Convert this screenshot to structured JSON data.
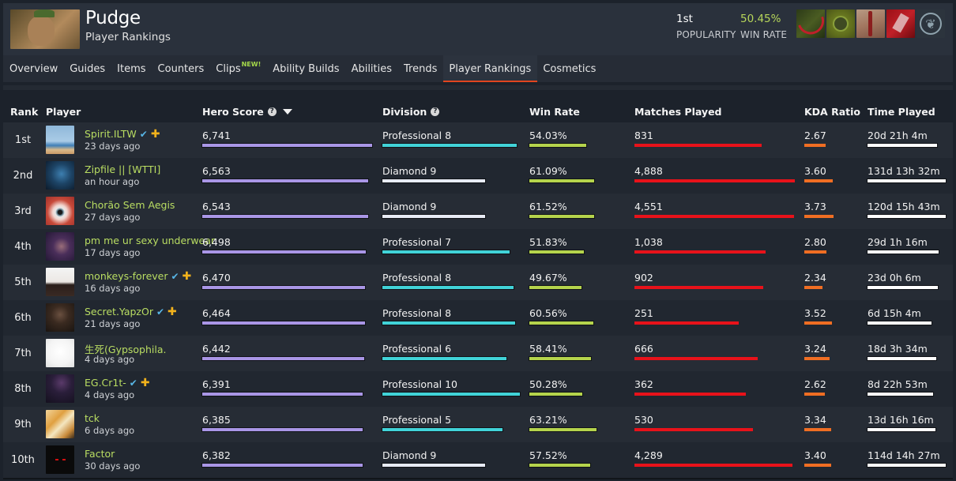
{
  "hero": {
    "name": "Pudge",
    "subtitle": "Player Rankings",
    "popularity_value": "1st",
    "popularity_label": "POPULARITY",
    "win_rate_value": "50.45%",
    "win_rate_label": "WIN RATE",
    "abilities": [
      "meat-hook-icon",
      "rot-icon",
      "flesh-heap-icon",
      "dismember-icon",
      "talent-tree-icon"
    ]
  },
  "nav": {
    "items": [
      {
        "label": "Overview"
      },
      {
        "label": "Guides"
      },
      {
        "label": "Items"
      },
      {
        "label": "Counters"
      },
      {
        "label": "Clips",
        "badge": "NEW!"
      },
      {
        "label": "Ability Builds"
      },
      {
        "label": "Abilities"
      },
      {
        "label": "Trends"
      },
      {
        "label": "Player Rankings",
        "active": true
      },
      {
        "label": "Cosmetics"
      }
    ]
  },
  "colors": {
    "hero_score_bar": "#a996e6",
    "professional_bar": "#41d3d8",
    "diamond_bar": "#e7ebf5",
    "win_rate_bar": "#b5d44c",
    "matches_bar": "#e8121a",
    "kda_bar": "#f06e23",
    "time_bar": "#ffffff",
    "accent": "#e2451f",
    "player_name": "#b9dd62"
  },
  "table": {
    "headers": {
      "rank": "Rank",
      "player": "Player",
      "hero_score": "Hero Score",
      "division": "Division",
      "win_rate": "Win Rate",
      "matches": "Matches Played",
      "kda": "KDA Ratio",
      "time": "Time Played"
    },
    "rows": [
      {
        "rank": "1st",
        "name": "Spirit.ILTW",
        "verified": true,
        "plus": true,
        "last_seen": "23 days ago",
        "hero_score": "6,741",
        "hero_score_frac": 1.0,
        "division": "Professional 8",
        "division_type": "professional",
        "division_frac": 0.977,
        "win_rate": "54.03%",
        "win_rate_frac": 0.847,
        "matches": "831",
        "matches_frac": 0.792,
        "kda": "2.67",
        "kda_frac": 0.73,
        "time": "20d 21h 4m",
        "time_frac": 0.889,
        "avatar": "fox"
      },
      {
        "rank": "2nd",
        "name": "Zipfile || [WTTI]",
        "verified": false,
        "plus": false,
        "last_seen": "an hour ago",
        "hero_score": "6,563",
        "hero_score_frac": 0.977,
        "division": "Diamond 9",
        "division_type": "diamond",
        "division_frac": 0.747,
        "win_rate": "61.09%",
        "win_rate_frac": 0.965,
        "matches": "4,888",
        "matches_frac": 1.0,
        "kda": "3.60",
        "kda_frac": 0.973,
        "time": "131d 13h 32m",
        "time_frac": 1.0,
        "avatar": "blue-face"
      },
      {
        "rank": "3rd",
        "name": "Chorão Sem Aegis",
        "verified": false,
        "plus": false,
        "last_seen": "27 days ago",
        "hero_score": "6,543",
        "hero_score_frac": 0.977,
        "division": "Diamond 9",
        "division_type": "diamond",
        "division_frac": 0.747,
        "win_rate": "61.52%",
        "win_rate_frac": 0.965,
        "matches": "4,551",
        "matches_frac": 0.995,
        "kda": "3.73",
        "kda_frac": 1.0,
        "time": "120d 15h 43m",
        "time_frac": 1.0,
        "avatar": "eye"
      },
      {
        "rank": "4th",
        "name": "pm me ur sexy underwear",
        "verified": false,
        "plus": false,
        "last_seen": "17 days ago",
        "hero_score": "6,498",
        "hero_score_frac": 0.963,
        "division": "Professional 7",
        "division_type": "professional",
        "division_frac": 0.925,
        "win_rate": "51.83%",
        "win_rate_frac": 0.812,
        "matches": "1,038",
        "matches_frac": 0.817,
        "kda": "2.80",
        "kda_frac": 0.757,
        "time": "29d 1h 16m",
        "time_frac": 0.909,
        "avatar": "purple-woman"
      },
      {
        "rank": "5th",
        "name": "monkeys-forever",
        "verified": true,
        "plus": true,
        "last_seen": "16 days ago",
        "hero_score": "6,470",
        "hero_score_frac": 0.958,
        "division": "Professional 8",
        "division_type": "professional",
        "division_frac": 0.954,
        "win_rate": "49.67%",
        "win_rate_frac": 0.776,
        "matches": "902",
        "matches_frac": 0.802,
        "kda": "2.34",
        "kda_frac": 0.622,
        "time": "23d 0h 6m",
        "time_frac": 0.899,
        "avatar": "coach"
      },
      {
        "rank": "6th",
        "name": "Secret.YapzOr",
        "verified": true,
        "plus": true,
        "last_seen": "21 days ago",
        "hero_score": "6,464",
        "hero_score_frac": 0.958,
        "division": "Professional 8",
        "division_type": "professional",
        "division_frac": 0.966,
        "win_rate": "60.56%",
        "win_rate_frac": 0.953,
        "matches": "251",
        "matches_frac": 0.649,
        "kda": "3.52",
        "kda_frac": 0.946,
        "time": "6d 15h 4m",
        "time_frac": 0.818,
        "avatar": "bearded-man"
      },
      {
        "rank": "7th",
        "name": "生死(Gypsophila.",
        "verified": false,
        "plus": false,
        "last_seen": "4 days ago",
        "hero_score": "6,442",
        "hero_score_frac": 0.953,
        "division": "Professional 6",
        "division_type": "professional",
        "division_frac": 0.902,
        "win_rate": "58.41%",
        "win_rate_frac": 0.918,
        "matches": "666",
        "matches_frac": 0.767,
        "kda": "3.24",
        "kda_frac": 0.865,
        "time": "18d 3h 34m",
        "time_frac": 0.879,
        "avatar": "sketch"
      },
      {
        "rank": "8th",
        "name": "EG.Cr1t-",
        "verified": true,
        "plus": true,
        "last_seen": "4 days ago",
        "hero_score": "6,391",
        "hero_score_frac": 0.944,
        "division": "Professional 10",
        "division_type": "professional",
        "division_frac": 1.0,
        "win_rate": "50.28%",
        "win_rate_frac": 0.788,
        "matches": "362",
        "matches_frac": 0.693,
        "kda": "2.62",
        "kda_frac": 0.703,
        "time": "8d 22h 53m",
        "time_frac": 0.838,
        "avatar": "dark-abstract"
      },
      {
        "rank": "9th",
        "name": "tck",
        "verified": false,
        "plus": false,
        "last_seen": "6 days ago",
        "hero_score": "6,385",
        "hero_score_frac": 0.944,
        "division": "Professional 5",
        "division_type": "professional",
        "division_frac": 0.874,
        "win_rate": "63.21%",
        "win_rate_frac": 1.0,
        "matches": "530",
        "matches_frac": 0.738,
        "kda": "3.34",
        "kda_frac": 0.919,
        "time": "13d 16h 16m",
        "time_frac": 0.869,
        "avatar": "painting"
      },
      {
        "rank": "10th",
        "name": "Factor",
        "verified": false,
        "plus": false,
        "last_seen": "30 days ago",
        "hero_score": "6,382",
        "hero_score_frac": 0.944,
        "division": "Diamond 9",
        "division_type": "diamond",
        "division_frac": 0.747,
        "win_rate": "57.52%",
        "win_rate_frac": 0.906,
        "matches": "4,289",
        "matches_frac": 0.985,
        "kda": "3.40",
        "kda_frac": 0.919,
        "time": "114d 14h 27m",
        "time_frac": 1.0,
        "avatar": "red-eyes"
      }
    ]
  }
}
